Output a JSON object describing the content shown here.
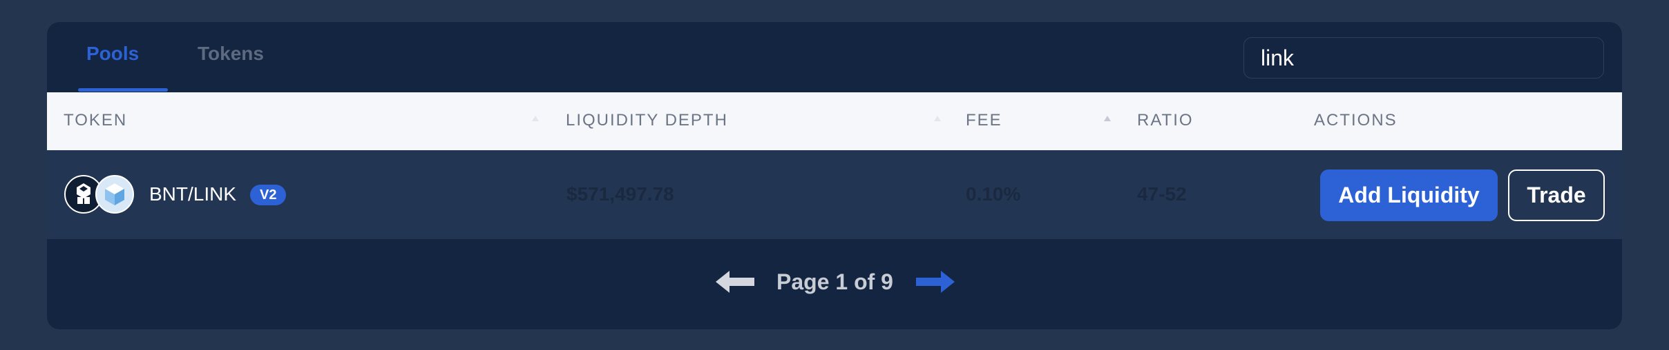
{
  "tabs": [
    {
      "label": "Pools",
      "active": true
    },
    {
      "label": "Tokens",
      "active": false
    }
  ],
  "search": {
    "value": "link"
  },
  "table": {
    "headers": [
      "TOKEN",
      "LIQUIDITY DEPTH",
      "FEE",
      "RATIO",
      "ACTIONS"
    ],
    "rows": [
      {
        "token": "BNT/LINK",
        "version": "V2",
        "logos": [
          "bnt-logo",
          "link-logo"
        ],
        "liquidity_depth": "$571,497.78",
        "fee": "0.10%",
        "ratio": "47-52",
        "actions": {
          "add_liquidity": "Add Liquidity",
          "trade": "Trade"
        }
      }
    ]
  },
  "pagination": {
    "label": "Page 1 of 9"
  },
  "colors": {
    "page_bg": "#243550",
    "card_bg": "#132540",
    "accent": "#2c62d6",
    "header_bg": "#f6f7fb",
    "row_bg": "#223553"
  },
  "icons": {
    "prev": "arrow-left-icon",
    "next": "arrow-right-icon"
  }
}
